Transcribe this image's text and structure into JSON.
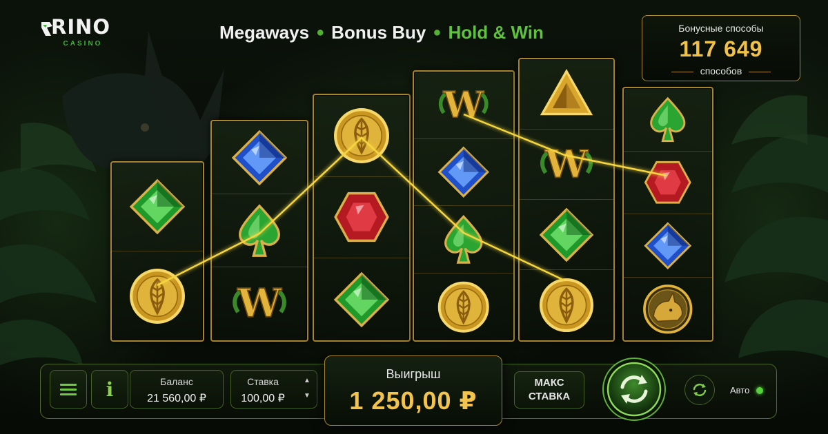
{
  "brand": {
    "name": "RINO",
    "sub": "CASINO"
  },
  "features": [
    "Megaways",
    "Bonus Buy",
    "Hold & Win"
  ],
  "bonus_ways": {
    "title": "Бонусные способы",
    "value": "117 649",
    "subtitle": "способов"
  },
  "reels": [
    [
      "emerald",
      "gold-coin"
    ],
    [
      "sapphire",
      "emerald-spade",
      "wild"
    ],
    [
      "gold-coin",
      "ruby",
      "emerald"
    ],
    [
      "wild",
      "sapphire",
      "emerald-spade",
      "gold-coin"
    ],
    [
      "gold-pyramid",
      "wild",
      "emerald",
      "gold-coin"
    ],
    [
      "emerald-spade",
      "ruby",
      "sapphire",
      "rhino-medallion"
    ]
  ],
  "controls": {
    "menu_icon": "menu-icon",
    "info_label": "i",
    "balance_label": "Баланс",
    "balance_value": "21 560,00 ₽",
    "stake_label": "Ставка",
    "stake_value": "100,00 ₽",
    "win_label": "Выигрыш",
    "win_value": "1 250,00 ₽",
    "max_bet_line1": "МАКС",
    "max_bet_line2": "СТАВКА",
    "auto_label": "Авто"
  },
  "colors": {
    "gold": "#f0c24a",
    "accent_green": "#5fc23c",
    "frame_gold": "#a8842c",
    "payline": "#f6d640"
  }
}
